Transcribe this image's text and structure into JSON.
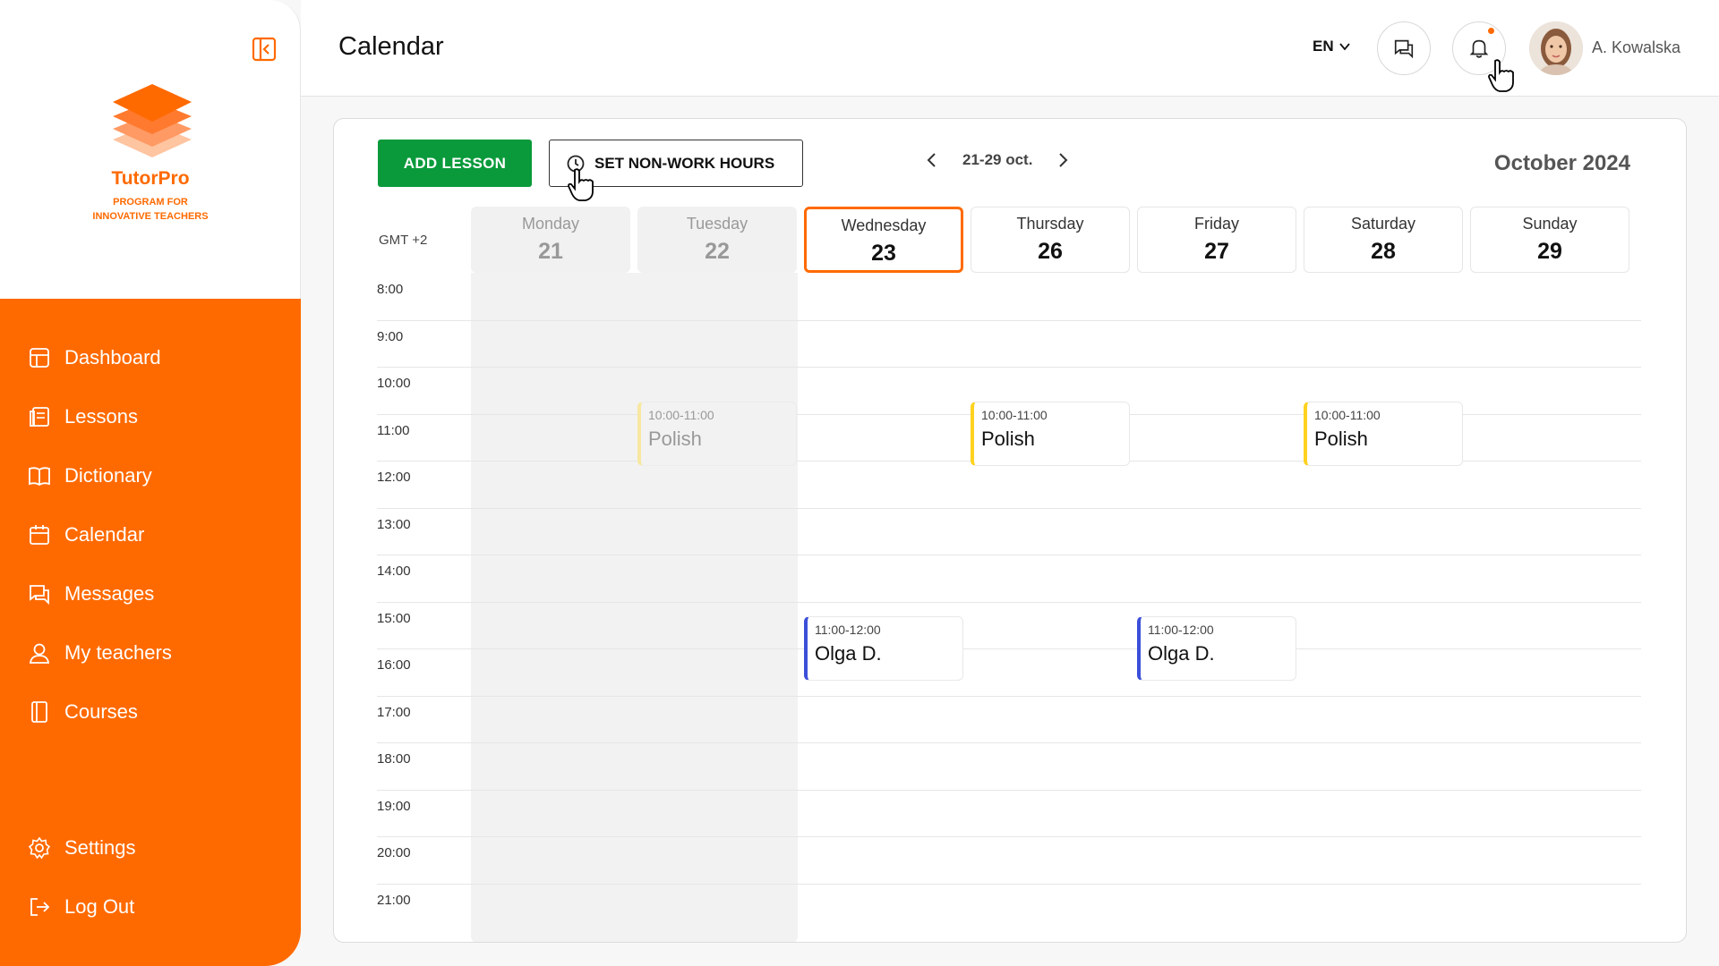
{
  "brand": {
    "name": "TutorPro",
    "tagline_line1": "PROGRAM FOR",
    "tagline_line2": "INNOVATIVE TEACHERS",
    "accent": "#ff6a00"
  },
  "sidebar": {
    "items": [
      {
        "label": "Dashboard",
        "icon": "dashboard-icon"
      },
      {
        "label": "Lessons",
        "icon": "lessons-icon"
      },
      {
        "label": "Dictionary",
        "icon": "book-icon"
      },
      {
        "label": "Calendar",
        "icon": "calendar-icon"
      },
      {
        "label": "Messages",
        "icon": "messages-icon"
      },
      {
        "label": "My teachers",
        "icon": "user-icon"
      },
      {
        "label": "Courses",
        "icon": "courses-icon"
      }
    ],
    "settings_label": "Settings",
    "logout_label": "Log Out"
  },
  "header": {
    "title": "Calendar",
    "language": "EN",
    "user_name": "A. Kowalska"
  },
  "toolbar": {
    "add_lesson": "ADD LESSON",
    "non_work_hours": "SET NON-WORK HOURS",
    "week_range": "21-29 oct.",
    "month": "October 2024"
  },
  "calendar": {
    "timezone": "GMT +2",
    "days": [
      {
        "name": "Monday",
        "num": "21",
        "state": "past"
      },
      {
        "name": "Tuesday",
        "num": "22",
        "state": "past"
      },
      {
        "name": "Wednesday",
        "num": "23",
        "state": "today"
      },
      {
        "name": "Thursday",
        "num": "26",
        "state": "future"
      },
      {
        "name": "Friday",
        "num": "27",
        "state": "future"
      },
      {
        "name": "Saturday",
        "num": "28",
        "state": "future"
      },
      {
        "name": "Sunday",
        "num": "29",
        "state": "future"
      }
    ],
    "hours": [
      "8:00",
      "9:00",
      "10:00",
      "11:00",
      "12:00",
      "13:00",
      "14:00",
      "15:00",
      "16:00",
      "17:00",
      "18:00",
      "19:00",
      "20:00",
      "21:00"
    ],
    "events": [
      {
        "time": "10:00-11:00",
        "title": "Polish"
      },
      {
        "time": "10:00-11:00",
        "title": "Polish"
      },
      {
        "time": "10:00-11:00",
        "title": "Polish"
      },
      {
        "time": "11:00-12:00",
        "title": "Olga D."
      },
      {
        "time": "11:00-12:00",
        "title": "Olga D."
      }
    ]
  }
}
